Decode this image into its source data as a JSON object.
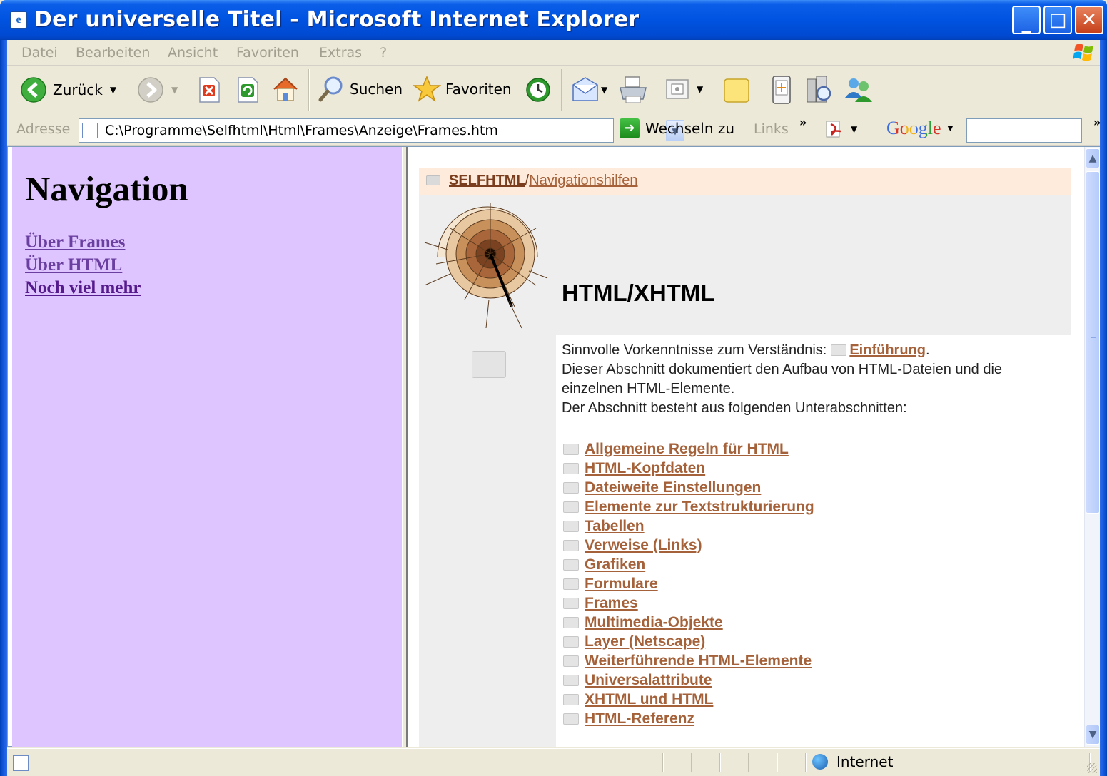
{
  "window": {
    "title": "Der universelle Titel - Microsoft Internet Explorer",
    "app_icon": "ie-page-icon",
    "minimize_glyph": "_",
    "maximize_glyph": "□",
    "close_glyph": "✕"
  },
  "menu": {
    "items": [
      "Datei",
      "Bearbeiten",
      "Ansicht",
      "Favoriten",
      "Extras",
      "?"
    ]
  },
  "toolbar": {
    "back_label": "Zurück",
    "search_label": "Suchen",
    "favorites_label": "Favoriten",
    "icons": [
      "back-icon",
      "forward-icon",
      "stop-icon",
      "refresh-icon",
      "home-icon",
      "search-icon",
      "favorites-star-icon",
      "history-icon",
      "mail-icon",
      "print-icon",
      "edit-icon",
      "discuss-icon",
      "messenger-icon",
      "research-icon",
      "msn-people-icon"
    ]
  },
  "addressbar": {
    "label": "Adresse",
    "url": "C:\\Programme\\Selfhtml\\Html\\Frames\\Anzeige\\Frames.htm",
    "go_label": "Wechseln zu",
    "links_label": "Links",
    "chevron": "»",
    "google_label": "Google",
    "google_placeholder": ""
  },
  "left_frame": {
    "heading": "Navigation",
    "links": [
      "Über Frames",
      "Über HTML",
      "Noch viel mehr"
    ],
    "link_colors": [
      "#551A8B",
      "#551A8B",
      "#551A8B"
    ],
    "background": "#DFC5FF"
  },
  "right_frame": {
    "breadcrumb": {
      "home": "SELFHTML",
      "separator": "/",
      "current": "Navigationshilfen"
    },
    "heading": "HTML/XHTML",
    "intro": {
      "prereq_text": "Sinnvolle Vorkenntnisse zum Verständnis:",
      "prereq_link": "Einführung",
      "prereq_end": ".",
      "line2": "Dieser Abschnitt dokumentiert den Aufbau von HTML-Dateien und die einzelnen HTML-Elemente.",
      "line3": "Der Abschnitt besteht aus folgenden Unterabschnitten:"
    },
    "sections": [
      "Allgemeine Regeln für HTML",
      "HTML-Kopfdaten",
      "Dateiweite Einstellungen",
      "Elemente zur Textstrukturierung",
      "Tabellen",
      "Verweise (Links)",
      "Grafiken",
      "Formulare",
      "Frames",
      "Multimedia-Objekte",
      "Layer (Netscape)",
      "Weiterführende HTML-Elemente",
      "Universalattribute",
      "XHTML und HTML",
      "HTML-Referenz"
    ],
    "link_color": "#A5623A",
    "breadcrumb_bg": "#FFEBDB"
  },
  "statusbar": {
    "zone": "Internet"
  }
}
